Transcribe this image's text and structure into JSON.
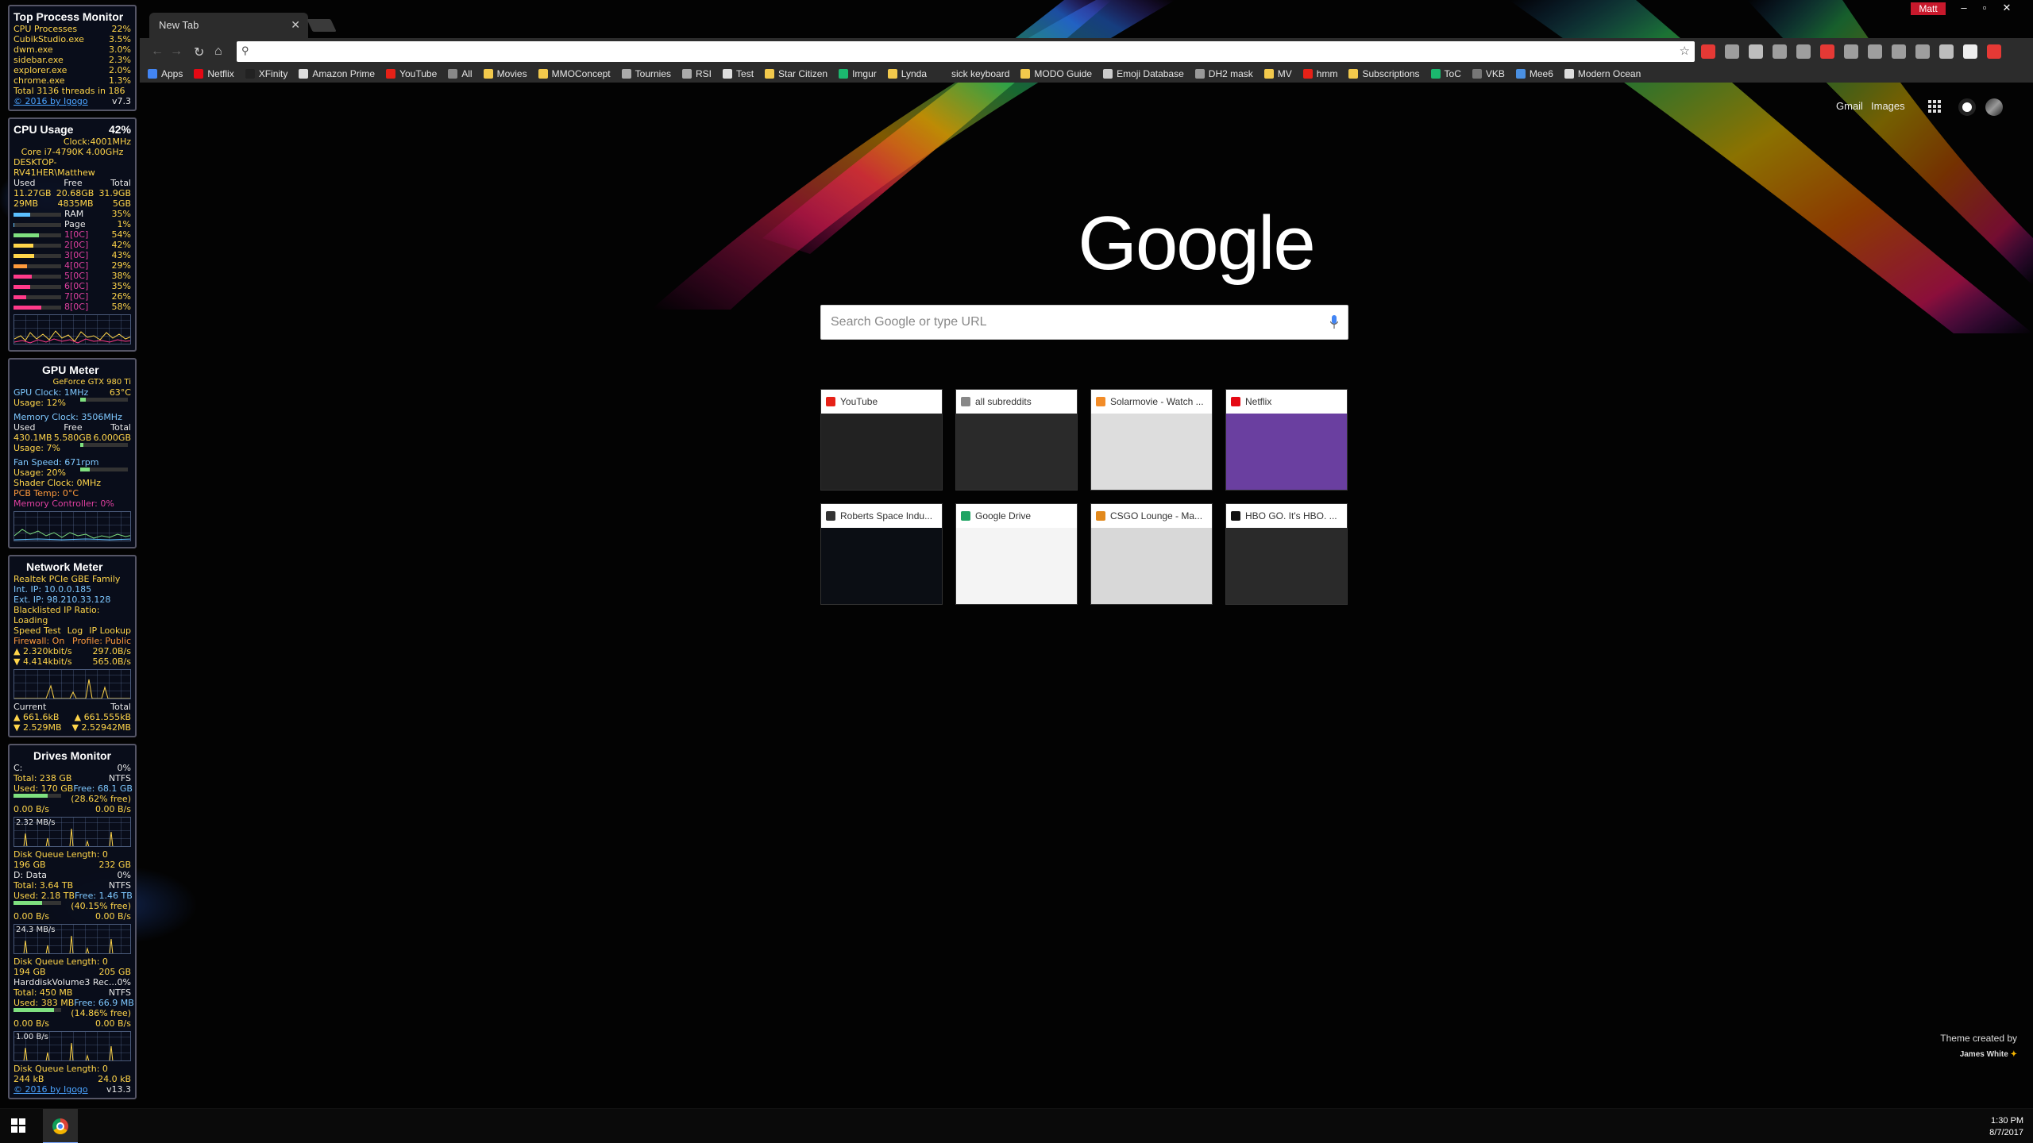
{
  "gadgets": {
    "top_process": {
      "title": "Top Process Monitor",
      "cpu_label": "CPU Processes",
      "cpu_value": "22%",
      "processes": [
        {
          "name": "CubikStudio.exe",
          "value": "3.5%"
        },
        {
          "name": "dwm.exe",
          "value": "3.0%"
        },
        {
          "name": "sidebar.exe",
          "value": "2.3%"
        },
        {
          "name": "explorer.exe",
          "value": "2.0%"
        },
        {
          "name": "chrome.exe",
          "value": "1.3%"
        }
      ],
      "threads": "Total 3136 threads in 186",
      "footer": "© 2016 by Igogo",
      "version": "v7.3"
    },
    "cpu": {
      "title": "CPU Usage",
      "usage": "42%",
      "clock": "Clock:4001MHz",
      "model": "Core i7-4790K 4.00GHz",
      "host": "DESKTOP-RV41HER\\Matthew",
      "headers": [
        "Used",
        "Free",
        "Total"
      ],
      "mem_row1": [
        "11.27GB",
        "20.68GB",
        "31.9GB"
      ],
      "mem_row2": [
        "29MB",
        "4835MB",
        "5GB"
      ],
      "ram_label": "RAM",
      "ram_value": "35%",
      "page_label": "Page",
      "page_value": "1%",
      "cores": [
        {
          "label": "1[0C]",
          "value": "54%",
          "level": 0.54
        },
        {
          "label": "2[0C]",
          "value": "42%",
          "level": 0.42
        },
        {
          "label": "3[0C]",
          "value": "43%",
          "level": 0.43
        },
        {
          "label": "4[0C]",
          "value": "29%",
          "level": 0.29
        },
        {
          "label": "5[0C]",
          "value": "38%",
          "level": 0.38
        },
        {
          "label": "6[0C]",
          "value": "35%",
          "level": 0.35
        },
        {
          "label": "7[0C]",
          "value": "26%",
          "level": 0.26
        },
        {
          "label": "8[0C]",
          "value": "58%",
          "level": 0.58
        }
      ]
    },
    "gpu": {
      "title": "GPU Meter",
      "model": "GeForce GTX 980 Ti",
      "gpu_clock": "GPU Clock: 1MHz",
      "temp": "63°C",
      "usage": "Usage: 12%",
      "mem_clock": "Memory Clock: 3506MHz",
      "headers": [
        "Used",
        "Free",
        "Total"
      ],
      "mem": [
        "430.1MB",
        "5.580GB",
        "6.000GB"
      ],
      "mem_usage": "Usage: 7%",
      "fan": "Fan Speed: 671rpm",
      "fan_usage": "Usage: 20%",
      "shader": "Shader Clock: 0MHz",
      "pcb": "PCB Temp: 0°C",
      "memctrl": "Memory Controller: 0%"
    },
    "network": {
      "title": "Network Meter",
      "adapter": "Realtek PCIe GBE Family",
      "int_ip": "Int. IP: 10.0.0.185",
      "ext_ip": "Ext. IP: 98.210.33.128",
      "blacklist": "Blacklisted IP Ratio: Loading",
      "links": [
        "Speed Test",
        "Log",
        "IP Lookup"
      ],
      "firewall": "Firewall: On",
      "profile": "Profile: Public",
      "up_rate": "2.320kbit/s",
      "up_total": "297.0B/s",
      "down_rate": "4.414kbit/s",
      "down_total": "565.0B/s",
      "current_label": "Current",
      "total_label": "Total",
      "cur_up": "661.6kB",
      "tot_up": "661.555kB",
      "cur_down": "2.529MB",
      "tot_down": "2.52942MB"
    },
    "drives": {
      "title": "Drives Monitor",
      "drives": [
        {
          "name": "C:",
          "pct": "0%",
          "total": "Total: 238 GB",
          "fs": "NTFS",
          "used": "Used: 170 GB",
          "free": "Free: 68.1 GB",
          "freepct": "(28.62% free)",
          "r": "0.00 B/s",
          "w": "0.00 B/s",
          "rate": "2.32 MB/s",
          "queue": "Disk Queue Length: 0",
          "a": "196 GB",
          "b": "232 GB",
          "fill": 0.71
        },
        {
          "name": "D: Data",
          "pct": "0%",
          "total": "Total: 3.64 TB",
          "fs": "NTFS",
          "used": "Used: 2.18 TB",
          "free": "Free: 1.46 TB",
          "freepct": "(40.15% free)",
          "r": "0.00 B/s",
          "w": "0.00 B/s",
          "rate": "24.3 MB/s",
          "queue": "Disk Queue Length: 0",
          "a": "194 GB",
          "b": "205 GB",
          "fill": 0.6
        },
        {
          "name": "HarddiskVolume3 Rec...",
          "pct": "0%",
          "total": "Total: 450 MB",
          "fs": "NTFS",
          "used": "Used: 383 MB",
          "free": "Free: 66.9 MB",
          "freepct": "(14.86% free)",
          "r": "0.00 B/s",
          "w": "0.00 B/s",
          "rate": "1.00 B/s",
          "queue": "Disk Queue Length: 0",
          "a": "244 kB",
          "b": "24.0 kB",
          "fill": 0.85
        }
      ],
      "footer": "© 2016 by Igogo",
      "version": "v13.3"
    }
  },
  "browser": {
    "tab_title": "New Tab",
    "profile_name": "Matt",
    "omnibox_value": "",
    "bookmarks": [
      {
        "label": "Apps",
        "color": "#4285f4"
      },
      {
        "label": "Netflix",
        "color": "#e50914"
      },
      {
        "label": "XFinity",
        "color": "#222"
      },
      {
        "label": "Amazon Prime",
        "color": "#ddd"
      },
      {
        "label": "YouTube",
        "color": "#e62117"
      },
      {
        "label": "All",
        "color": "#888"
      },
      {
        "label": "Movies",
        "color": "#f2c94c"
      },
      {
        "label": "MMOConcept",
        "color": "#f2c94c"
      },
      {
        "label": "Tournies",
        "color": "#aaa"
      },
      {
        "label": "RSI",
        "color": "#aaa"
      },
      {
        "label": "Test",
        "color": "#ddd"
      },
      {
        "label": "Star Citizen",
        "color": "#f2c94c"
      },
      {
        "label": "Imgur",
        "color": "#1bb76e"
      },
      {
        "label": "Lynda",
        "color": "#f2c94c"
      },
      {
        "label": "sick keyboard",
        "color": "transparent"
      },
      {
        "label": "MODO Guide",
        "color": "#f2c94c"
      },
      {
        "label": "Emoji Database",
        "color": "#ccc"
      },
      {
        "label": "DH2 mask",
        "color": "#999"
      },
      {
        "label": "MV",
        "color": "#f2c94c"
      },
      {
        "label": "hmm",
        "color": "#e62117"
      },
      {
        "label": "Subscriptions",
        "color": "#f2c94c"
      },
      {
        "label": "ToC",
        "color": "#1bb76e"
      },
      {
        "label": "VKB",
        "color": "#777"
      },
      {
        "label": "Mee6",
        "color": "#4a90e2"
      },
      {
        "label": "Modern Ocean",
        "color": "#ddd"
      }
    ]
  },
  "ntp": {
    "gmail": "Gmail",
    "images": "Images",
    "logo": "Google",
    "search_placeholder": "Search Google or type URL",
    "tiles": [
      {
        "title": "YouTube",
        "fav_color": "#e62117",
        "thumb": "#222"
      },
      {
        "title": "all subreddits",
        "fav_color": "#888",
        "thumb": "#2a2a2a"
      },
      {
        "title": "Solarmovie - Watch ...",
        "fav_color": "#f28c28",
        "thumb": "#ddd"
      },
      {
        "title": "Netflix",
        "fav_color": "#e50914",
        "thumb": "#6a3fa0"
      },
      {
        "title": "Roberts Space Indu...",
        "fav_color": "#333",
        "thumb": "#0b0e14"
      },
      {
        "title": "Google Drive",
        "fav_color": "#1fa463",
        "thumb": "#f4f4f4"
      },
      {
        "title": "CSGO Lounge - Ma...",
        "fav_color": "#e2891c",
        "thumb": "#d8d8d8"
      },
      {
        "title": "HBO GO. It's HBO. ...",
        "fav_color": "#111",
        "thumb": "#2a2a2a"
      }
    ],
    "credit_line1": "Theme created by",
    "credit_line2": "James White"
  },
  "taskbar": {
    "time": "1:30 PM",
    "date": "8/7/2017"
  }
}
